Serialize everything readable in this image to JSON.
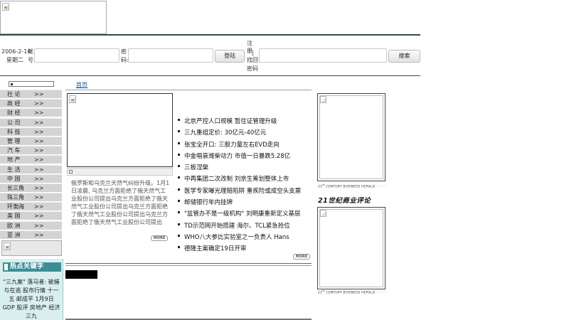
{
  "header": {
    "date": "2006-2-14",
    "weekday": "星期二",
    "account_label_1": "帐",
    "account_label_2": "号:",
    "password_label_1": "密",
    "password_label_2": "码:",
    "login_button": "登陆",
    "register_link": "注册",
    "separator": "|",
    "forgot_link_1": "找回",
    "forgot_link_2": "密码",
    "search_button": "搜索"
  },
  "sidebar": {
    "items": [
      {
        "label": "社 论",
        "arrow": ">>"
      },
      {
        "label": "政 经",
        "arrow": ">>"
      },
      {
        "label": "财 经",
        "arrow": ">>"
      },
      {
        "label": "公 司",
        "arrow": ">>"
      },
      {
        "label": "科 技",
        "arrow": ">>"
      },
      {
        "label": "管 理",
        "arrow": ">>"
      },
      {
        "label": "汽 车",
        "arrow": ">>"
      },
      {
        "label": "地 产",
        "arrow": ">>"
      },
      {
        "label": "生 活",
        "arrow": ">>"
      },
      {
        "label": "中 国",
        "arrow": ">>"
      },
      {
        "label": "长三角",
        "arrow": ">>"
      },
      {
        "label": "珠三角",
        "arrow": ">>"
      },
      {
        "label": "环渤海",
        "arrow": ">>"
      },
      {
        "label": "美 国",
        "arrow": ">>"
      },
      {
        "label": "欧 洲",
        "arrow": ">>"
      },
      {
        "label": "亚 洲",
        "arrow": ">>"
      }
    ]
  },
  "hot_keywords": {
    "title": "热点关键字",
    "text": "\"三九案\" 落马者: 被捕与在逃 股市行情 十一五 邮成平 1月9日 GDP 股评 房地产 经济 三九"
  },
  "main": {
    "breadcrumb": "首页",
    "featured_text": "俄罗斯和乌克兰天然气纠纷升级。1月1日凌晨, 乌克兰方面拒绝了俄天然气工业股份公司提出乌克兰方面拒绝了俄天然气工业股份公司提出乌克兰方面拒绝了俄天然气工业股份公司提出乌克兰方面拒绝了俄天然气工业股份公司提出",
    "more_label": "MORE",
    "headlines": [
      "北京严控人口规模 暂住证管理升级",
      "三九重组定价: 30亿元-40亿元",
      "张宝全开口: 三股力量左右EVD走向",
      "中金唱衰潍柴动力 市值一日暴跌5.28亿",
      "三板涅槃",
      "中再集团二次改制 刘京生筹划整体上市",
      "医学专家曝光理赔陷阱  重疾险或成空头支票",
      "邮储银行年内挂牌",
      "\"监管办不是一级机构\" 刘明康重新定义基层",
      "TD示范网开始搭建 海尔、TCL紧急抢位",
      "WHO八大参比实验室之一负责人 Hans",
      "德隆主案确定19日开审"
    ]
  },
  "right": {
    "herald_prefix": "21",
    "herald_sup": "st",
    "herald_text": " CENTURY BUSINESS HERALD",
    "herald_dots": "·········",
    "review_title": "21世纪商业评论"
  }
}
